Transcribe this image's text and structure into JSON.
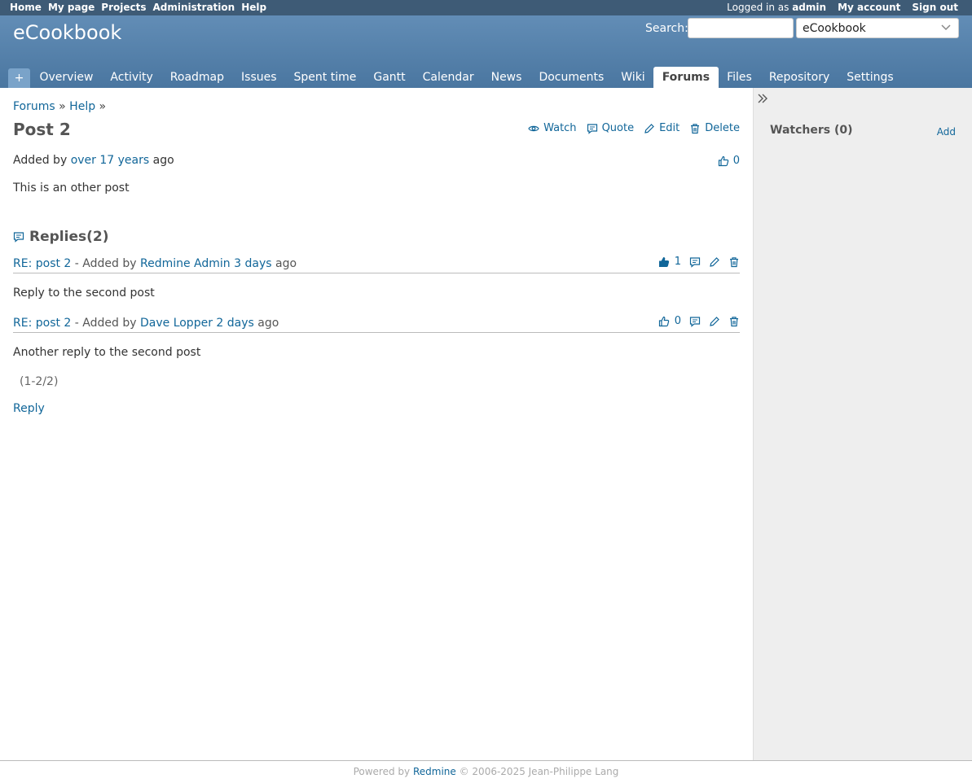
{
  "top_menu": {
    "left_items": [
      "Home",
      "My page",
      "Projects",
      "Administration",
      "Help"
    ],
    "logged_in_prefix": "Logged in as",
    "user": "admin",
    "right_items": [
      "My account",
      "Sign out"
    ]
  },
  "header": {
    "project_title": "eCookbook",
    "search_label": "Search:",
    "project_jump_value": "eCookbook"
  },
  "main_menu": {
    "plus_label": "+",
    "tabs": [
      "Overview",
      "Activity",
      "Roadmap",
      "Issues",
      "Spent time",
      "Gantt",
      "Calendar",
      "News",
      "Documents",
      "Wiki",
      "Forums",
      "Files",
      "Repository",
      "Settings"
    ],
    "selected": "Forums"
  },
  "breadcrumb": {
    "items": [
      "Forums",
      "Help"
    ],
    "separator": "»"
  },
  "post": {
    "title": "Post 2",
    "actions": [
      "Watch",
      "Quote",
      "Edit",
      "Delete"
    ],
    "added_by_prefix": "Added by",
    "age_link": "over 17 years",
    "age_suffix": "ago",
    "likes": "0",
    "body": "This is an other post"
  },
  "replies": {
    "heading": "Replies(2)",
    "items": [
      {
        "subject": "RE: post 2",
        "added_by": "- Added by",
        "author": "Redmine Admin",
        "age": "3 days",
        "age_suffix": "ago",
        "likes": "1",
        "liked": true,
        "body": "Reply to the second post"
      },
      {
        "subject": "RE: post 2",
        "added_by": "- Added by",
        "author": "Dave Lopper",
        "age": "2 days",
        "age_suffix": "ago",
        "likes": "0",
        "liked": false,
        "body": "Another reply to the second post"
      }
    ],
    "pagination": "(1-2/2)",
    "reply_link": "Reply"
  },
  "sidebar": {
    "watchers_title": "Watchers (0)",
    "add_label": "Add"
  },
  "footer": {
    "prefix": "Powered by",
    "link": "Redmine",
    "suffix": "© 2006-2025 Jean-Philippe Lang"
  },
  "colors": {
    "link": "#116699",
    "top_menu": "#3e5b76",
    "header": "#628db6",
    "sidebar": "#eeeeee"
  }
}
